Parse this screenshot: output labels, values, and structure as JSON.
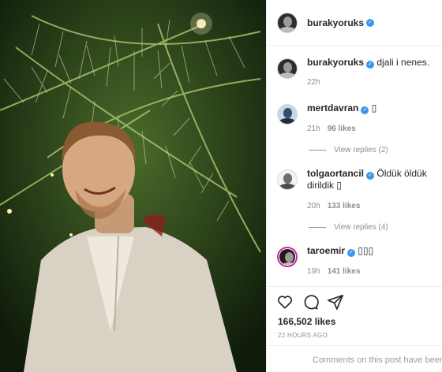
{
  "post": {
    "author": "burakyoruks",
    "caption": "djali i nenes.",
    "caption_time": "22h",
    "likes": "166,502 likes",
    "time_ago": "22 HOURS AGO",
    "footer_notice": "Comments on this post have been limit"
  },
  "comments": [
    {
      "user": "mertdavran",
      "text": "▯",
      "time": "21h",
      "likes": "96 likes",
      "replies": "View replies (2)"
    },
    {
      "user": "tolgaortancil",
      "text": "Öldük öldük dirildik ▯",
      "time": "20h",
      "likes": "133 likes",
      "replies": "View replies (4)"
    },
    {
      "user": "taroemir",
      "text": "▯▯▯",
      "time": "19h",
      "likes": "141 likes",
      "replies": ""
    }
  ],
  "icons": [
    "heart-icon",
    "comment-icon",
    "share-icon",
    "verified-icon"
  ],
  "colors": {
    "accent": "#3897f0",
    "muted": "#8e8e8e",
    "text": "#262626",
    "story_ring": "#d6249f"
  }
}
